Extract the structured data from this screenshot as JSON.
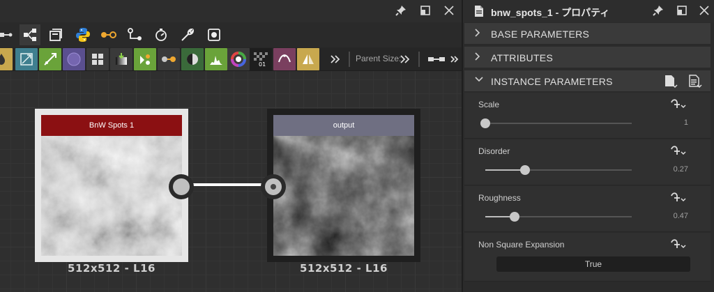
{
  "graph": {
    "toolbar2": {
      "parent_size_label": "Parent Size:"
    },
    "nodes": [
      {
        "title": "BnW Spots 1",
        "caption": "512x512 - L16",
        "title_color": "#8b1012",
        "frame_color": "#e6e6e6"
      },
      {
        "title": "output",
        "caption": "512x512 - L16",
        "title_color": "#6f6f82",
        "frame_color": "#1f1f1f"
      }
    ]
  },
  "props": {
    "title": "bnw_spots_1 - プロパティ",
    "sections": [
      {
        "label": "BASE PARAMETERS",
        "expanded": false
      },
      {
        "label": "ATTRIBUTES",
        "expanded": false
      },
      {
        "label": "INSTANCE PARAMETERS",
        "expanded": true
      }
    ],
    "params": [
      {
        "label": "Scale",
        "value": "1",
        "fraction": 0.0
      },
      {
        "label": "Disorder",
        "value": "0.27",
        "fraction": 0.27
      },
      {
        "label": "Roughness",
        "value": "0.47",
        "fraction": 0.2
      },
      {
        "label": "Non Square Expansion",
        "value": "True"
      }
    ]
  },
  "colors": {
    "accent_blue": "#2f7fd6",
    "python_yellow": "#f5c518",
    "node_red": "#8b1012"
  }
}
